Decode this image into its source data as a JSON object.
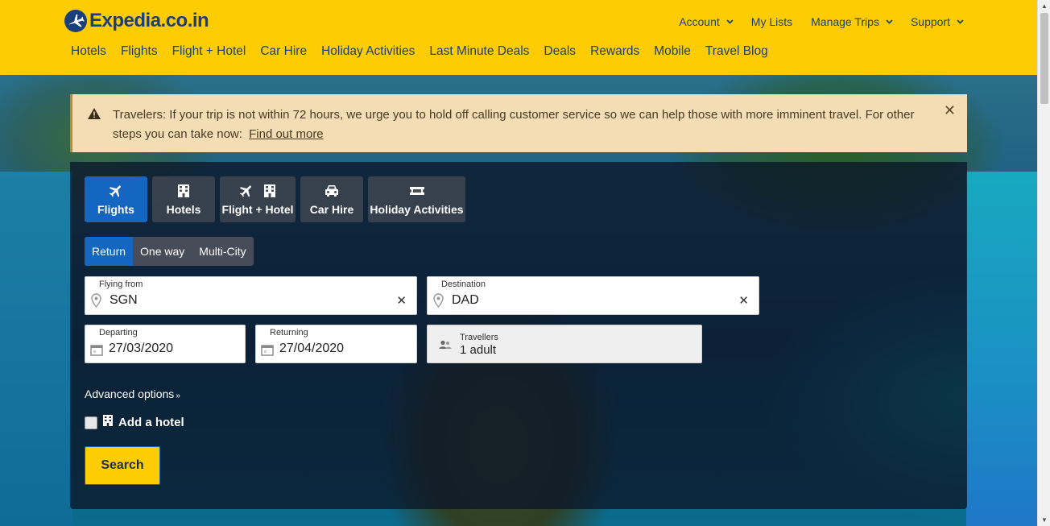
{
  "header": {
    "logo_text": "Expedia.co.in",
    "top_links": [
      {
        "label": "Account",
        "caret": true
      },
      {
        "label": "My Lists",
        "caret": false
      },
      {
        "label": "Manage Trips",
        "caret": true
      },
      {
        "label": "Support",
        "caret": true
      }
    ],
    "nav": [
      "Hotels",
      "Flights",
      "Flight + Hotel",
      "Car Hire",
      "Holiday Activities",
      "Last Minute Deals",
      "Deals",
      "Rewards",
      "Mobile",
      "Travel Blog"
    ]
  },
  "alert": {
    "text": "Travelers: If your trip is not within 72 hours, we urge you to hold off calling customer service so we can help those with more imminent travel. For other steps you can take now:",
    "link": "Find out more"
  },
  "search": {
    "tabs": [
      "Flights",
      "Hotels",
      "Flight + Hotel",
      "Car Hire",
      "Holiday Activities"
    ],
    "trip_types": [
      "Return",
      "One way",
      "Multi-City"
    ],
    "from_label": "Flying from",
    "from_value": "SGN",
    "dest_label": "Destination",
    "dest_value": "DAD",
    "depart_label": "Departing",
    "depart_value": "27/03/2020",
    "return_label": "Returning",
    "return_value": "27/04/2020",
    "travellers_label": "Travellers",
    "travellers_value": "1 adult",
    "advanced": "Advanced options",
    "add_hotel": "Add a hotel",
    "search_button": "Search"
  },
  "colors": {
    "brand_yellow": "#fecc02",
    "brand_blue": "#1b3f7a",
    "active_blue": "#1566c0",
    "alert_bg": "#f3ddb4"
  }
}
